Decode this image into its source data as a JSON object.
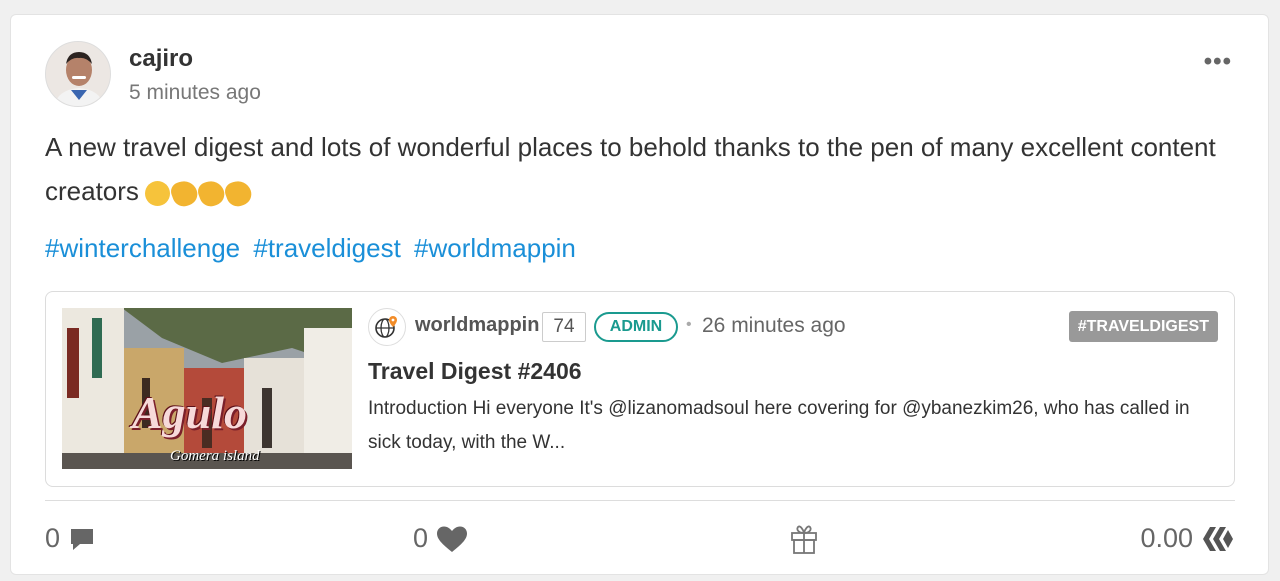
{
  "post": {
    "author": "cajiro",
    "time": "5 minutes ago",
    "body": "A new travel digest and lots of wonderful places to behold thanks to the pen of many excellent content creators",
    "emojis": [
      "party-face",
      "clap",
      "clap",
      "clap"
    ],
    "hashtags": [
      "#winterchallenge",
      "#traveldigest",
      "#worldmappin"
    ],
    "more_icon": "ellipsis-icon"
  },
  "embed": {
    "thumbnail_text": "Agulo",
    "thumbnail_subtext": "Gomera island",
    "author": "worldmappin",
    "reputation": "74",
    "role": "ADMIN",
    "time": "26 minutes ago",
    "tag": "#TRAVELDIGEST",
    "title": "Travel Digest #2406",
    "snippet": "Introduction Hi everyone It's @lizanomadsoul here covering for @ybanezkim26, who has called in sick today, with the W..."
  },
  "footer": {
    "comments": "0",
    "votes": "0",
    "payout": "0.00"
  },
  "colors": {
    "link": "#1a8fd8",
    "admin": "#1a9a8f",
    "badge": "#999999"
  }
}
